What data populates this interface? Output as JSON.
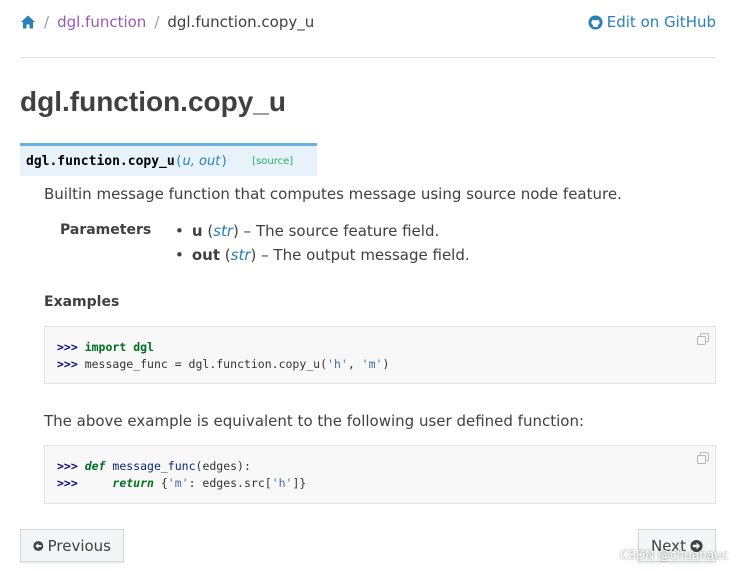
{
  "breadcrumb": {
    "home_icon": "home-icon",
    "sep": "/",
    "items": [
      {
        "label": "dgl.function"
      },
      {
        "label": "dgl.function.copy_u"
      }
    ]
  },
  "edit_link": {
    "icon": "github-icon",
    "label": "Edit on GitHub"
  },
  "page_title": "dgl.function.copy_u",
  "signature": {
    "name": "dgl.function.copy_u",
    "open": "(",
    "args": "u, out",
    "close": ")",
    "source_label": "[source]"
  },
  "description": "Builtin message function that computes message using source node feature.",
  "parameters": {
    "label": "Parameters",
    "items": [
      {
        "name": "u",
        "open": " (",
        "type": "str",
        "close": ")",
        "desc": " – The source feature field."
      },
      {
        "name": "out",
        "open": " (",
        "type": "str",
        "close": ")",
        "desc": " – The output message field."
      }
    ]
  },
  "examples_heading": "Examples",
  "code1": {
    "line1": {
      "prompt": ">>> ",
      "kw": "import",
      "sp": " ",
      "mod": "dgl"
    },
    "line2": {
      "prompt": ">>> ",
      "text1": "message_func = dgl.function.copy_u(",
      "s1": "'h'",
      "comma": ", ",
      "s2": "'m'",
      "end": ")"
    }
  },
  "equivalent_text": "The above example is equivalent to the following user defined function:",
  "code2": {
    "line1": {
      "prompt": ">>> ",
      "kw": "def",
      "sp": " ",
      "fn": "message_func",
      "rest": "(edges):"
    },
    "line2": {
      "prompt": ">>>     ",
      "kw": "return",
      "t1": " {",
      "s1": "'m'",
      "t2": ": edges.src[",
      "s2": "'h'",
      "t3": "]}"
    }
  },
  "nav": {
    "previous_label": "Previous",
    "next_label": "Next"
  },
  "watermark": "CSDN @chuanauc",
  "colors": {
    "link": "#2980b9",
    "visited": "#9b59b6",
    "signature_bg": "#e7f2fa",
    "signature_border": "#6ab0de",
    "source_label": "#27ae60"
  }
}
